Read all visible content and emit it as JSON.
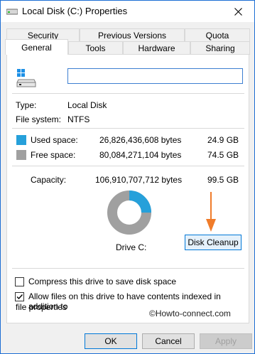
{
  "window": {
    "title": "Local Disk (C:) Properties"
  },
  "tabs": {
    "row1": [
      "Security",
      "Previous Versions",
      "Quota"
    ],
    "row2": [
      "General",
      "Tools",
      "Hardware",
      "Sharing"
    ],
    "active": "General"
  },
  "general": {
    "name_value": "",
    "type_label": "Type:",
    "type_value": "Local Disk",
    "fs_label": "File system:",
    "fs_value": "NTFS",
    "used_label": "Used space:",
    "used_bytes": "26,826,436,608 bytes",
    "used_gb": "24.9 GB",
    "free_label": "Free space:",
    "free_bytes": "80,084,271,104 bytes",
    "free_gb": "74.5 GB",
    "capacity_label": "Capacity:",
    "capacity_bytes": "106,910,707,712 bytes",
    "capacity_gb": "99.5 GB",
    "drive_label": "Drive C:",
    "disk_cleanup_label": "Disk Cleanup",
    "used_fraction": 0.25,
    "used_color": "#26a0da",
    "free_color": "#a0a0a0",
    "compress_label": "Compress this drive to save disk space",
    "compress_checked": false,
    "index_label_line1": "Allow files on this drive to have contents indexed in addition to",
    "index_label_line2": "file properties",
    "index_checked": true,
    "watermark": "©Howto-connect.com",
    "arrow_color": "#f07c2a"
  },
  "footer": {
    "ok_label": "OK",
    "cancel_label": "Cancel",
    "apply_label": "Apply"
  }
}
